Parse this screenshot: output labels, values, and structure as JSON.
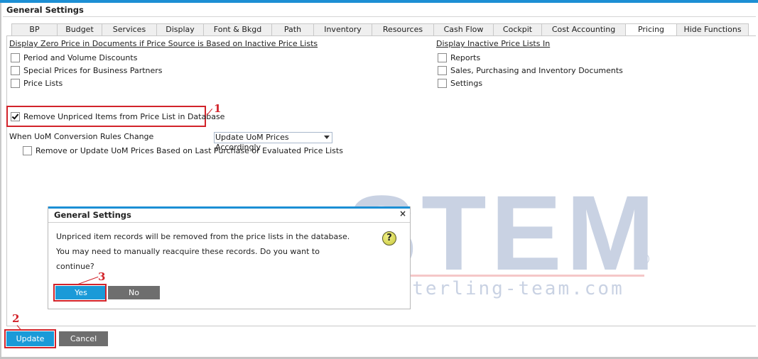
{
  "window": {
    "title": "General Settings"
  },
  "tabs": [
    {
      "label": "BP",
      "active": false
    },
    {
      "label": "Budget",
      "active": false
    },
    {
      "label": "Services",
      "active": false
    },
    {
      "label": "Display",
      "active": false
    },
    {
      "label": "Font & Bkgd",
      "active": false
    },
    {
      "label": "Path",
      "active": false
    },
    {
      "label": "Inventory",
      "active": false
    },
    {
      "label": "Resources",
      "active": false
    },
    {
      "label": "Cash Flow",
      "active": false
    },
    {
      "label": "Cockpit",
      "active": false
    },
    {
      "label": "Cost Accounting",
      "active": false
    },
    {
      "label": "Pricing",
      "active": true
    },
    {
      "label": "Hide Functions",
      "active": false
    }
  ],
  "zero_price_section": {
    "title": "Display Zero Price in Documents if Price Source is Based on Inactive Price Lists",
    "options": [
      {
        "label": "Period and Volume Discounts",
        "checked": false
      },
      {
        "label": "Special Prices for Business Partners",
        "checked": false
      },
      {
        "label": "Price Lists",
        "checked": false
      }
    ]
  },
  "inactive_section": {
    "title": "Display Inactive Price Lists In",
    "options": [
      {
        "label": "Reports",
        "checked": false
      },
      {
        "label": "Sales, Purchasing and Inventory Documents",
        "checked": false
      },
      {
        "label": "Settings",
        "checked": false
      }
    ]
  },
  "remove_unpriced": {
    "label": "Remove Unpriced Items from Price List in Database",
    "checked": true
  },
  "uom": {
    "label": "When UoM Conversion Rules Change",
    "selected": "Update UoM Prices Accordingly",
    "sub_option": {
      "label": "Remove or Update UoM Prices Based on Last Purchase or Evaluated Price Lists",
      "checked": false
    }
  },
  "callouts": {
    "one": "1",
    "two": "2",
    "three": "3"
  },
  "dialog": {
    "title": "General Settings",
    "message": "Unpriced item records will be removed from the price lists in the database. You may need to manually reacquire these records. Do you want to continue?",
    "close_glyph": "×",
    "help_glyph": "?",
    "yes_label": "Yes",
    "no_label": "No"
  },
  "footer": {
    "update_label": "Update",
    "cancel_label": "Cancel"
  },
  "watermark": {
    "brand": "STEM",
    "url": "www.sterling-team.com",
    "reg": "®"
  },
  "colors": {
    "accent": "#1c8fd4",
    "button_primary": "#1a9ad8",
    "button_secondary": "#6e6e6e",
    "annotation": "#d2232a"
  }
}
